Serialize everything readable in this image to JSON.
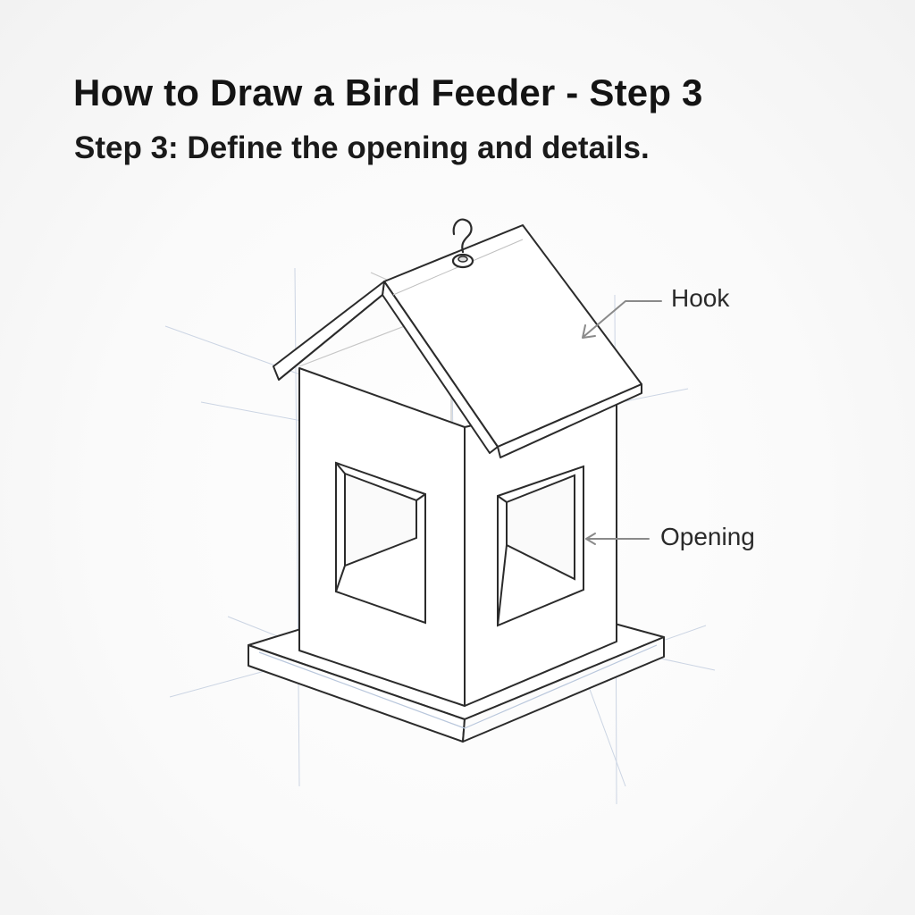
{
  "title": "How to Draw a Bird Feeder - Step 3",
  "subtitle": "Step 3: Define the opening and details.",
  "labels": {
    "hook": "Hook",
    "opening": "Opening"
  },
  "colors": {
    "ink": "#2b2b2b",
    "construction": "#b9c7dc",
    "guide": "#c9c9c9",
    "arrow": "#8a8a8a",
    "text": "#141414"
  }
}
